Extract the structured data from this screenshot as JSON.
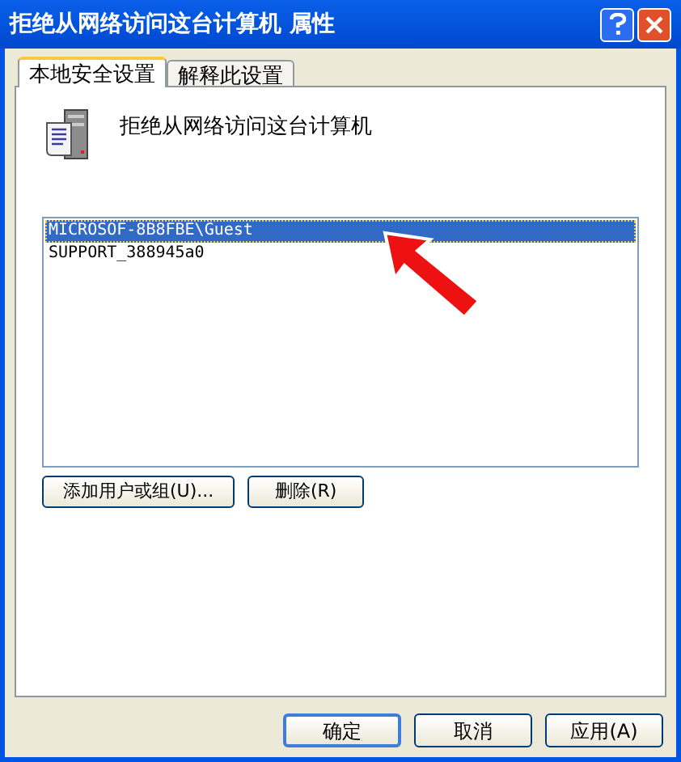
{
  "window": {
    "title": "拒绝从网络访问这台计算机 属性"
  },
  "tabs": [
    {
      "label": "本地安全设置",
      "selected": true
    },
    {
      "label": "解释此设置",
      "selected": false
    }
  ],
  "policy": {
    "name": "拒绝从网络访问这台计算机"
  },
  "accounts": [
    {
      "label": "MICROSOF-8B8FBE\\Guest",
      "selected": true
    },
    {
      "label": "SUPPORT_388945a0",
      "selected": false
    }
  ],
  "list_buttons": [
    "添加用户或组(U)...",
    "删除(R)"
  ],
  "dialog_buttons": [
    {
      "label": "确定",
      "default": true
    },
    {
      "label": "取消",
      "default": false
    },
    {
      "label": "应用(A)",
      "default": false
    }
  ]
}
